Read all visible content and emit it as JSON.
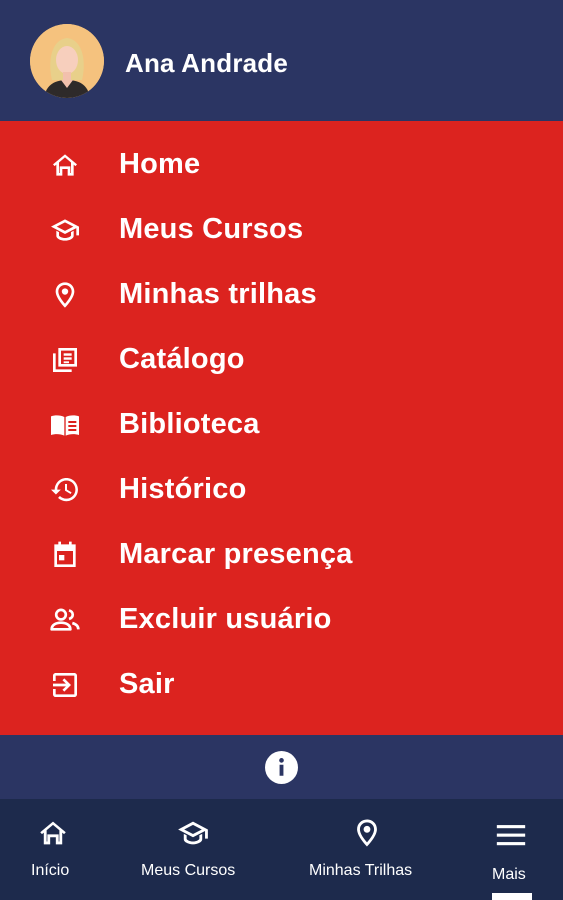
{
  "user": {
    "name": "Ana Andrade",
    "avatar_icon": "avatar-icon"
  },
  "menu": {
    "items": [
      {
        "label": "Home",
        "icon": "home-icon"
      },
      {
        "label": "Meus Cursos",
        "icon": "graduation-cap-icon"
      },
      {
        "label": "Minhas trilhas",
        "icon": "location-pin-icon"
      },
      {
        "label": "Catálogo",
        "icon": "catalog-icon"
      },
      {
        "label": "Biblioteca",
        "icon": "book-icon"
      },
      {
        "label": "Histórico",
        "icon": "history-icon"
      },
      {
        "label": "Marcar presença",
        "icon": "calendar-icon"
      },
      {
        "label": "Excluir usuário",
        "icon": "users-icon"
      },
      {
        "label": "Sair",
        "icon": "logout-icon"
      }
    ]
  },
  "info": {
    "icon": "info-icon"
  },
  "bottom_nav": {
    "items": [
      {
        "label": "Início",
        "icon": "home-icon"
      },
      {
        "label": "Meus Cursos",
        "icon": "graduation-cap-icon"
      },
      {
        "label": "Minhas Trilhas",
        "icon": "location-pin-icon"
      },
      {
        "label": "Mais",
        "icon": "hamburger-menu-icon",
        "active": true
      }
    ]
  },
  "colors": {
    "header_bg": "#2b3563",
    "menu_bg": "#dc231f",
    "bottom_nav_bg": "#1d2a4c",
    "text": "#ffffff"
  }
}
